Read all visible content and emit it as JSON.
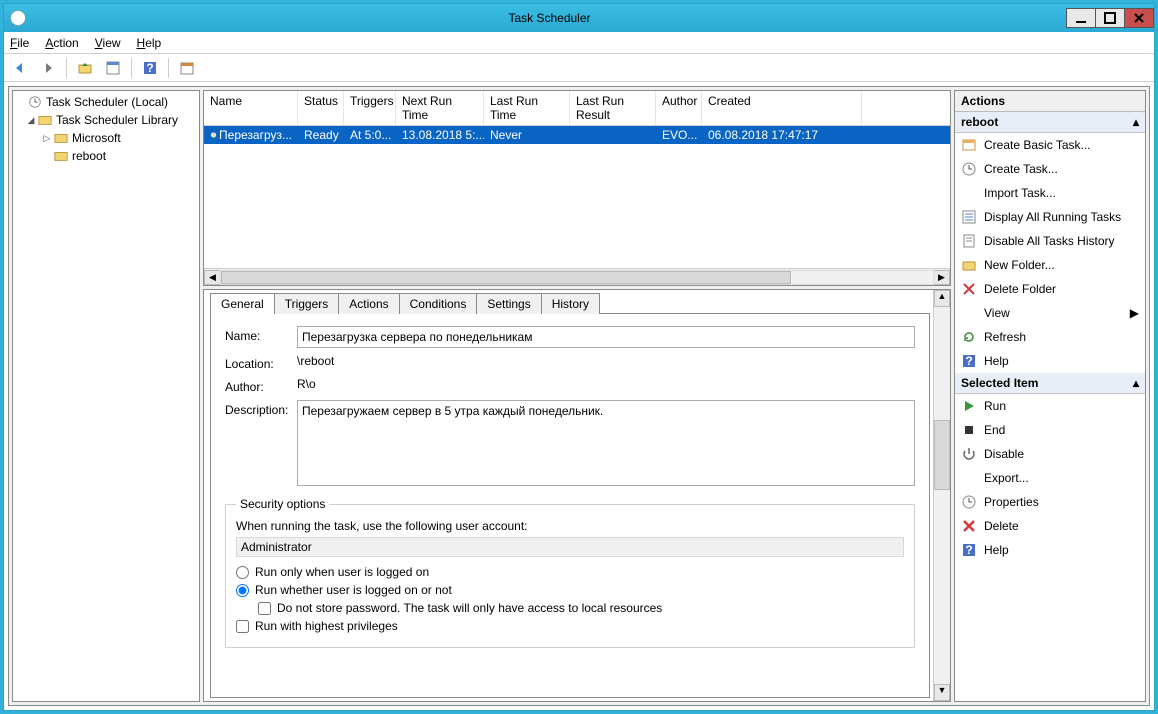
{
  "window_title": "Task Scheduler",
  "menubar": [
    "File",
    "Action",
    "View",
    "Help"
  ],
  "tree": {
    "root": "Task Scheduler (Local)",
    "lvl1": "Task Scheduler Library",
    "ms": "Microsoft",
    "reboot": "reboot"
  },
  "list": {
    "headers": [
      "Name",
      "Status",
      "Triggers",
      "Next Run Time",
      "Last Run Time",
      "Last Run Result",
      "Author",
      "Created"
    ],
    "row": {
      "name": "Перезагруз...",
      "status": "Ready",
      "triggers": "At 5:0...",
      "next": "13.08.2018 5:...",
      "last": "Never",
      "result": "",
      "author": "EVO...",
      "created": "06.08.2018 17:47:17"
    }
  },
  "tabs": [
    "General",
    "Triggers",
    "Actions",
    "Conditions",
    "Settings",
    "History"
  ],
  "general": {
    "labels": {
      "name": "Name:",
      "location": "Location:",
      "author": "Author:",
      "description": "Description:"
    },
    "name": "Перезагрузка сервера по понедельникам",
    "location": "\\reboot",
    "author": "R\\o",
    "description": "Перезагружаем сервер в 5 утра каждый понедельник.",
    "security_legend": "Security options",
    "sec_line1": "When running the task, use the following user account:",
    "sec_user": "Administrator",
    "radio1": "Run only when user is logged on",
    "radio2": "Run whether user is logged on or not",
    "chk1": "Do not store password.  The task will only have access to local resources",
    "chk2": "Run with highest privileges"
  },
  "actions": {
    "title": "Actions",
    "sect1": "reboot",
    "items1": [
      "Create Basic Task...",
      "Create Task...",
      "Import Task...",
      "Display All Running Tasks",
      "Disable All Tasks History",
      "New Folder...",
      "Delete Folder",
      "View",
      "Refresh",
      "Help"
    ],
    "sect2": "Selected Item",
    "items2": [
      "Run",
      "End",
      "Disable",
      "Export...",
      "Properties",
      "Delete",
      "Help"
    ]
  }
}
